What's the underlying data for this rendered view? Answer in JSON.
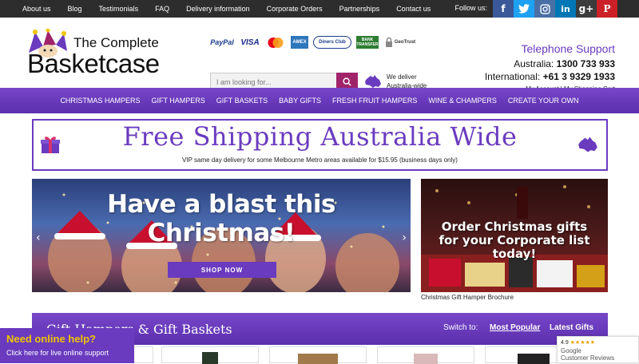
{
  "topbar": {
    "links": [
      "About us",
      "Blog",
      "Testimonials",
      "FAQ",
      "Delivery information",
      "Corporate Orders",
      "Partnerships",
      "Contact us"
    ],
    "follow_label": "Follow us:",
    "social": [
      {
        "icon": "facebook-icon",
        "glyph": "f",
        "color": "#3b5998"
      },
      {
        "icon": "twitter-icon",
        "glyph": "t",
        "color": "#1da1f2"
      },
      {
        "icon": "instagram-icon",
        "glyph": "◎",
        "color": "#4a6fa5"
      },
      {
        "icon": "linkedin-icon",
        "glyph": "in",
        "color": "#0077b5"
      },
      {
        "icon": "googleplus-icon",
        "glyph": "g+",
        "color": "#3c3c3c"
      },
      {
        "icon": "pinterest-icon",
        "glyph": "P",
        "color": "#cb2027"
      }
    ]
  },
  "header": {
    "logo_line1": "The Complete",
    "logo_line2": "Basketcase",
    "payments": [
      "PayPal",
      "VISA",
      "mastercard",
      "AMEX",
      "Diners Club",
      "BANK TRANSFER",
      "GeoTrust"
    ],
    "search_placeholder": "I am looking for...",
    "deliver_text": "We deliver Australia-wide",
    "telephone_title": "Telephone Support",
    "australia_label": "Australia:",
    "australia_phone": "1300 733 933",
    "international_label": "International:",
    "international_phone": "+61 3 9329 1933",
    "my_account": "My Account",
    "separator": "|",
    "my_cart": "My Shopping Cart"
  },
  "nav": {
    "items": [
      "CHRISTMAS HAMPERS",
      "GIFT HAMPERS",
      "GIFT BASKETS",
      "BABY GIFTS",
      "FRESH FRUIT HAMPERS",
      "WINE & CHAMPERS",
      "CREATE YOUR OWN"
    ]
  },
  "shipping": {
    "title": "Free Shipping Australia Wide",
    "subtitle": "VIP same day delivery for some Melbourne Metro areas available for $15.95 (business days only)"
  },
  "banner": {
    "title": "Have a blast this Christmas!",
    "button": "SHOP NOW"
  },
  "corporate": {
    "title_line1": "Order Christmas gifts",
    "title_line2": "for your Corporate list today!",
    "caption": "Christmas Gift Hamper Brochure"
  },
  "section": {
    "title": "Gift Hampers & Gift Baskets",
    "switch_label": "Switch to:",
    "most_popular": "Most Popular",
    "latest_gifts": "Latest Gifts"
  },
  "help": {
    "title": "Need online help?",
    "subtitle": "Click here for live online support"
  },
  "google": {
    "rating": "4.9",
    "stars": "★★★★★",
    "line1": "Google",
    "line2": "Customer Reviews"
  },
  "colors": {
    "brand_purple": "#6a3bbf",
    "search_button": "#a0246a",
    "topbar": "#2d2d2d"
  }
}
